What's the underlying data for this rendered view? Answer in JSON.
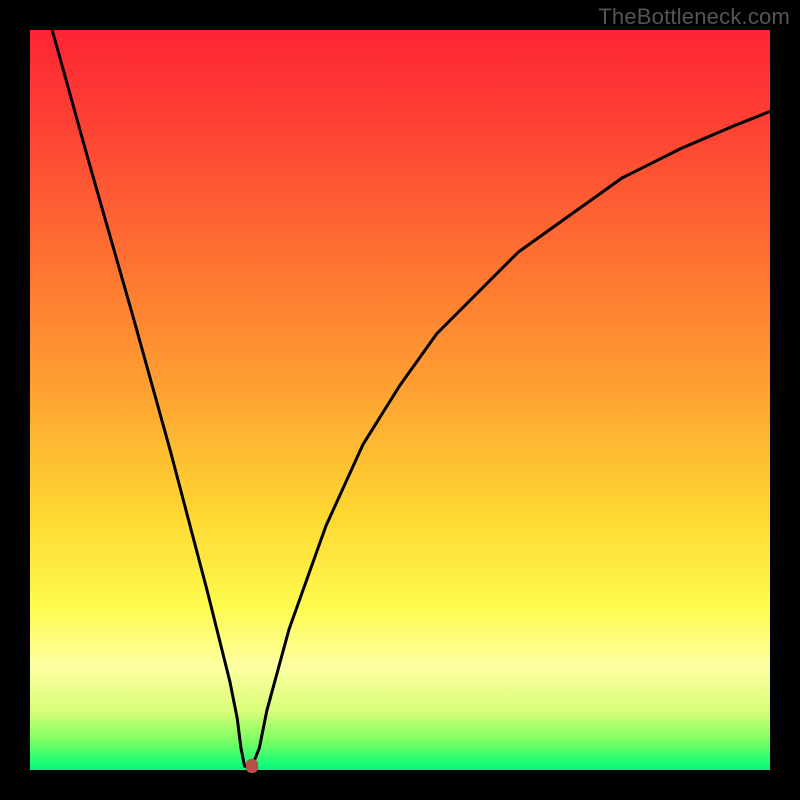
{
  "attribution": "TheBottleneck.com",
  "chart_data": {
    "type": "line",
    "title": "",
    "xlabel": "",
    "ylabel": "",
    "xlim": [
      0,
      100
    ],
    "ylim": [
      0,
      100
    ],
    "x": [
      3,
      8,
      14,
      19,
      24,
      27,
      28,
      28.5,
      29,
      30,
      31,
      32,
      35,
      40,
      45,
      50,
      55,
      60,
      66,
      73,
      80,
      88,
      95,
      100
    ],
    "y": [
      100,
      82,
      61,
      43,
      24,
      12,
      7,
      3,
      0.5,
      0.5,
      3,
      8,
      19,
      33,
      44,
      52,
      59,
      64,
      70,
      75,
      80,
      84,
      87,
      89
    ],
    "background": "vertical-gradient-red-to-green",
    "marker": {
      "x": 30,
      "y": 0.5,
      "color": "#b84e46"
    },
    "series": [
      {
        "name": "curve",
        "color": "#000000",
        "stroke_width": 3
      }
    ]
  }
}
